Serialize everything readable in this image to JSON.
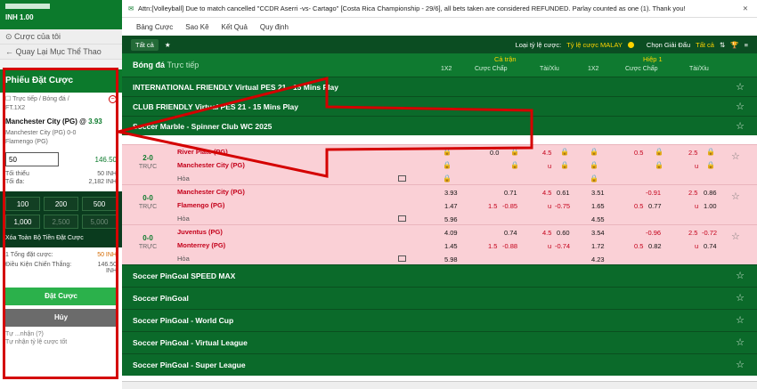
{
  "header": {
    "balance": "INH 1.00"
  },
  "left_menu": {
    "my_bets": "Cược của tôi",
    "back": "Quay Lại Mục Thể Thao"
  },
  "bet_slip": {
    "title": "Phiếu Đặt Cược",
    "path_line1": "Trực tiếp / Bóng đá /",
    "path_line2": "FT.1X2",
    "pick": "Manchester City (PG) @",
    "pick_odds": "3.93",
    "team_line1": "Manchester City (PG)  0-0",
    "team_line2": "Flamengo (PG)",
    "stake_value": "50",
    "stake_return": "146.50",
    "min_label": "Tối thiểu",
    "min_value": "50 INH",
    "max_label": "Tối đa:",
    "max_value": "2,182 INH",
    "chips": [
      "100",
      "200",
      "500",
      "1,000",
      "2,500",
      "5,000"
    ],
    "clear_label": "Xóa Toàn Bộ Tiền Đặt Cược",
    "total_label": "1 Tổng đặt cược:",
    "total_value": "50 INH",
    "win_label": "Điều Kiện Chiến Thắng:",
    "win_value": "146.50",
    "win_unit": "INH",
    "place_button": "Đặt Cược",
    "cancel_button": "Hủy",
    "footer1": "Tự ...nhận (?)",
    "footer2": "Tự nhận tỷ lệ cược tốt"
  },
  "ticker": {
    "text": "Attn:[Volleyball] Due to match cancelled \"CCDR Aserri -vs- Cartago\" [Costa Rica Championship - 29/6], all bets taken are considered REFUNDED. Parlay counted as one (1). Thank you!"
  },
  "nav": {
    "items": [
      "Bảng Cược",
      "Sao Kê",
      "Kết Quả",
      "Quy định"
    ]
  },
  "toolbar": {
    "all_tab": "Tất cả",
    "odds_type_label": "Loại tỷ lệ cược:",
    "odds_type_value": "Tỷ lệ cược MALAY",
    "league_label": "Chọn Giải Đấu",
    "league_value": "Tất cả"
  },
  "table_header": {
    "title": "Bóng đá",
    "subtitle": "Trực tiếp",
    "ft_label": "Cả trận",
    "h1_label": "Hiệp 1",
    "cols": [
      "1X2",
      "Cược Chấp",
      "Tài/Xỉu",
      "1X2",
      "Cược Chấp",
      "Tài/Xỉu"
    ]
  },
  "leagues_top": [
    "INTERNATIONAL FRIENDLY Virtual PES 21 - 15 Mins Play",
    "CLUB FRIENDLY Virtual PES 21 - 15 Mins Play",
    "Soccer Marble - Spinner Club WC 2025"
  ],
  "events": [
    {
      "score": "2-0",
      "status": "TRỰC",
      "home": "River Plate (PG)",
      "away": "Manchester City (PG)",
      "draw": "Hòa",
      "ft_hdp": "0.0",
      "ft_ou_line": "4.5",
      "ft_ou_under": "u",
      "h1_hdp": "0.5",
      "h1_ou_line": "2.5",
      "h1_ou_under": "u"
    },
    {
      "score": "0-0",
      "status": "TRỰC",
      "home": "Manchester City (PG)",
      "away": "Flamengo (PG)",
      "draw": "Hòa",
      "ft_1": "3.93",
      "ft_2": "1.47",
      "ft_x": "5.96",
      "ft_hdp_line": "1.5",
      "ft_hdp_h": "0.71",
      "ft_hdp_a": "-0.85",
      "ft_ou_line": "4.5",
      "ft_ou_o": "0.61",
      "ft_ou_u_label": "u",
      "ft_ou_u": "-0.75",
      "h1_1": "3.51",
      "h1_2": "1.65",
      "h1_x": "4.55",
      "h1_hdp_line": "0.5",
      "h1_hdp_h": "-0.91",
      "h1_hdp_a": "0.77",
      "h1_ou_line": "2.5",
      "h1_ou_o": "0.86",
      "h1_ou_u_label": "u",
      "h1_ou_u": "1.00"
    },
    {
      "score": "0-0",
      "status": "TRỰC",
      "home": "Juventus (PG)",
      "away": "Monterrey (PG)",
      "draw": "Hòa",
      "ft_1": "4.09",
      "ft_2": "1.45",
      "ft_x": "5.98",
      "ft_hdp_line": "1.5",
      "ft_hdp_h": "0.74",
      "ft_hdp_a": "-0.88",
      "ft_ou_line": "4.5",
      "ft_ou_o": "0.60",
      "ft_ou_u_label": "u",
      "ft_ou_u": "-0.74",
      "h1_1": "3.54",
      "h1_2": "1.72",
      "h1_x": "4.23",
      "h1_hdp_line": "0.5",
      "h1_hdp_h": "-0.96",
      "h1_hdp_a": "0.82",
      "h1_ou_line": "2.5",
      "h1_ou_o": "-0.72",
      "h1_ou_u_label": "u",
      "h1_ou_u": "0.74"
    }
  ],
  "leagues_bottom": [
    "Soccer PinGoal SPEED MAX",
    "Soccer PinGoal",
    "Soccer PinGoal - World Cup",
    "Soccer PinGoal - Virtual League",
    "Soccer PinGoal - Super League"
  ],
  "colors": {
    "brand_green": "#0c7a2c",
    "highlight_red": "#d40000",
    "row_pink": "#fad0d6"
  }
}
